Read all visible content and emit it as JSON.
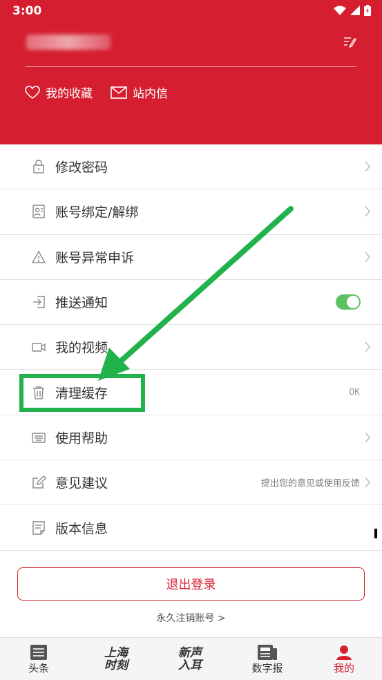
{
  "status": {
    "time": "3:00"
  },
  "header": {
    "favorites_label": "我的收藏",
    "messages_label": "站内信"
  },
  "menu": [
    {
      "label": "修改密码"
    },
    {
      "label": "账号绑定/解绑"
    },
    {
      "label": "账号异常申诉"
    },
    {
      "label": "推送通知"
    },
    {
      "label": "我的视频"
    },
    {
      "label": "清理缓存",
      "value": "OK"
    },
    {
      "label": "使用帮助"
    },
    {
      "label": "意见建议",
      "hint": "提出您的意见或使用反馈"
    },
    {
      "label": "版本信息"
    }
  ],
  "logout_label": "退出登录",
  "cancel_account_label": "永久注销账号 >",
  "tabs": [
    {
      "label": "头条"
    },
    {
      "brand": [
        "上海",
        "时刻"
      ]
    },
    {
      "brand": [
        "新声",
        "入耳"
      ]
    },
    {
      "label": "数字报"
    },
    {
      "label": "我的"
    }
  ],
  "colors": {
    "brand_red": "#d51f30",
    "toggle_green": "#5cc160",
    "annotation_green": "#22b24c"
  }
}
